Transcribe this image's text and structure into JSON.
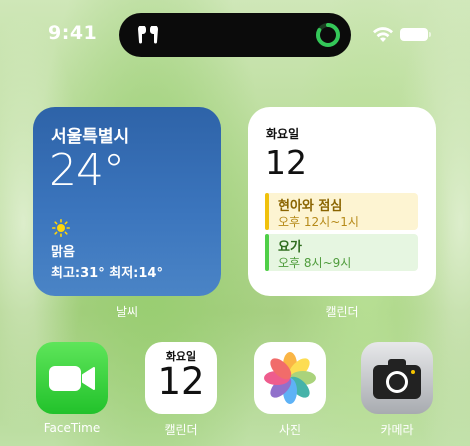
{
  "status_bar": {
    "time": "9:41",
    "icons": [
      "airpods-icon",
      "activity-ring-icon",
      "wifi-icon",
      "battery-icon"
    ],
    "ring_color": "#34c759"
  },
  "widgets": {
    "weather": {
      "city": "서울특별시",
      "temperature": "24°",
      "condition_icon": "sun-icon",
      "condition": "맑음",
      "range": "최고:31° 최저:14°",
      "label": "날씨",
      "color": "#3a74bc"
    },
    "calendar": {
      "weekday": "화요일",
      "date": "12",
      "events": [
        {
          "title": "현아와 점심",
          "time": "오후 12시~1시",
          "color": "#f0c10c"
        },
        {
          "title": "요가",
          "time": "오후 8시~9시",
          "color": "#4fcf47"
        }
      ],
      "label": "캘린더"
    }
  },
  "dock_apps": [
    {
      "name": "FaceTime",
      "icon": "facetime-icon"
    },
    {
      "name": "캘린더",
      "icon": "calendar-icon",
      "weekday": "화요일",
      "date": "12"
    },
    {
      "name": "사진",
      "icon": "photos-icon"
    },
    {
      "name": "카메라",
      "icon": "camera-icon"
    }
  ]
}
